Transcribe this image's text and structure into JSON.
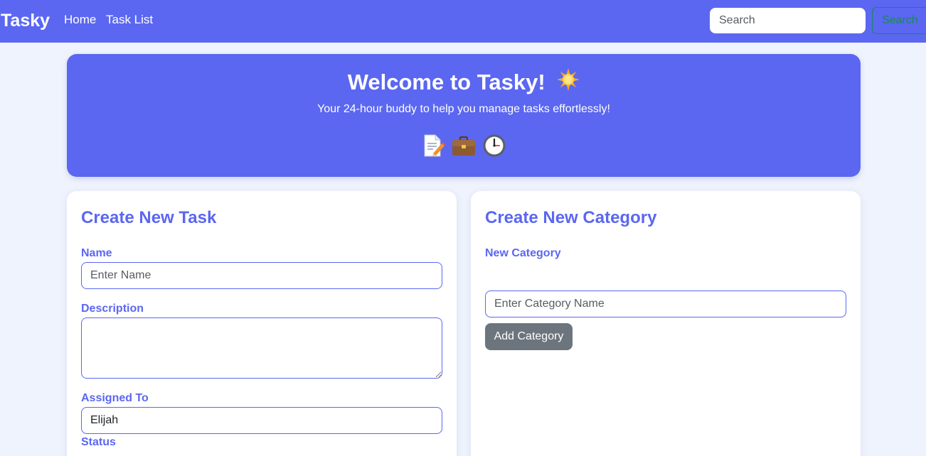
{
  "navbar": {
    "brand": "Tasky",
    "links": [
      {
        "label": "Home"
      },
      {
        "label": "Task List"
      }
    ],
    "search": {
      "placeholder": "Search",
      "value": "",
      "button_label": "Search"
    }
  },
  "hero": {
    "title": "Welcome to Tasky!",
    "title_icon": "sun-icon",
    "subtitle": "Your 24-hour buddy to help you manage tasks effortlessly!",
    "icons": [
      "memo-icon",
      "briefcase-icon",
      "clock-icon"
    ]
  },
  "task_form": {
    "title": "Create New Task",
    "name": {
      "label": "Name",
      "placeholder": "Enter Name",
      "value": ""
    },
    "description": {
      "label": "Description",
      "value": ""
    },
    "assigned_to": {
      "label": "Assigned To",
      "value": "Elijah"
    },
    "status": {
      "label": "Status"
    }
  },
  "category_form": {
    "title": "Create New Category",
    "label": "New Category",
    "placeholder": "Enter Category Name",
    "value": "",
    "button_label": "Add Category"
  },
  "colors": {
    "primary": "#5b67f1",
    "background": "#eef3fd",
    "secondary_button": "#6c757d",
    "success_outline": "#198754"
  }
}
